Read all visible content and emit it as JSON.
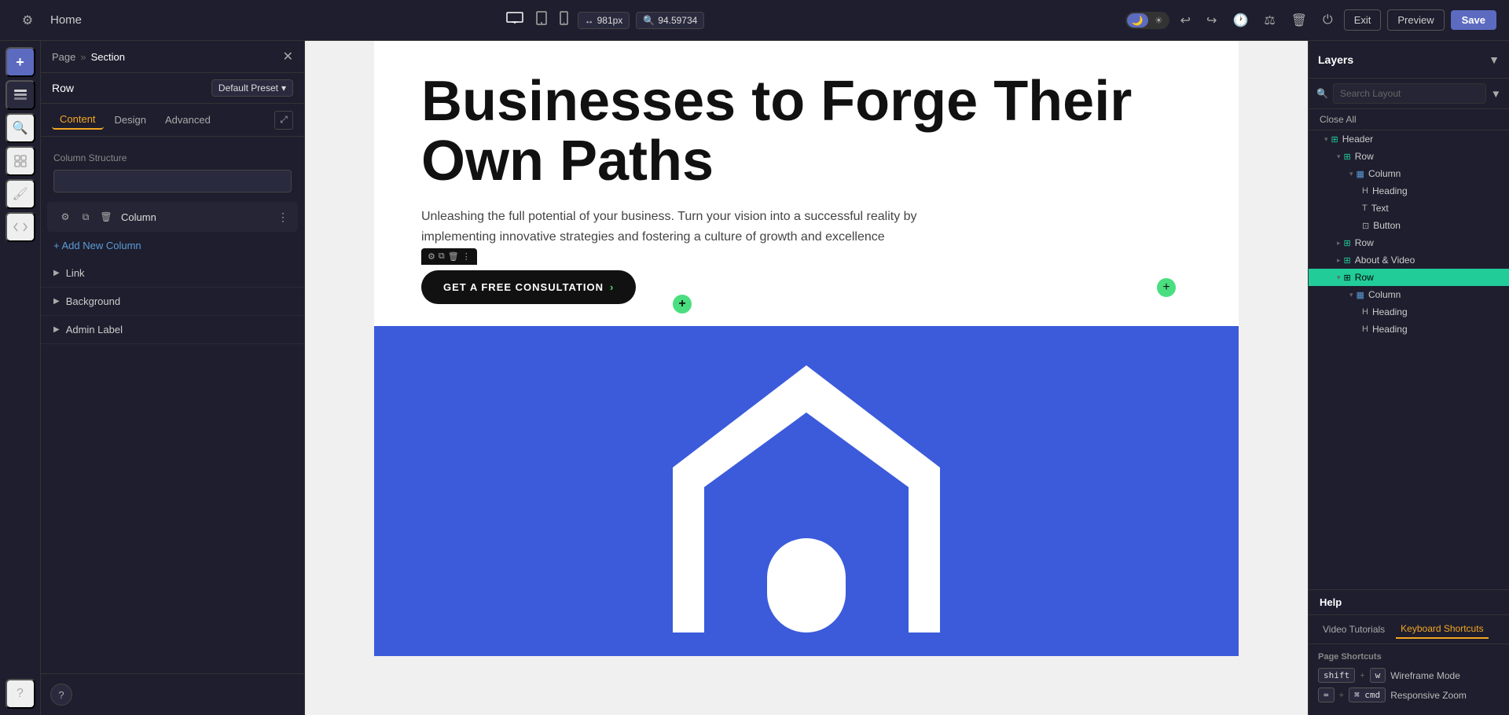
{
  "topbar": {
    "title": "Home",
    "gear_icon": "⚙",
    "device_desktop": "▭",
    "device_tablet": "⬜",
    "device_mobile": "📱",
    "px_label": "981px",
    "ruler_icon": "↔",
    "zoom_label": "94.59734",
    "search_icon": "🔍",
    "undo_icon": "↩",
    "redo_icon": "↪",
    "history_icon": "🕐",
    "settings_icon": "⚖",
    "trash_icon": "🗑",
    "power_icon": "⏻",
    "exit_label": "Exit",
    "preview_label": "Preview",
    "save_label": "Save"
  },
  "left_panel": {
    "breadcrumb_page": "Page",
    "breadcrumb_sep": "»",
    "breadcrumb_section": "Section",
    "row_label": "Row",
    "preset_label": "Default Preset",
    "tab_content": "Content",
    "tab_design": "Design",
    "tab_advanced": "Advanced",
    "column_structure_label": "Column Structure",
    "column_label": "Column",
    "add_column_label": "+ Add New Column",
    "section_link": "Link",
    "section_background": "Background",
    "section_admin": "Admin Label"
  },
  "layers": {
    "title": "Layers",
    "filter_icon": "▼",
    "search_placeholder": "Search Layout",
    "close_all": "Close All",
    "items": [
      {
        "label": "Header",
        "indent": 1,
        "icon": "⊞",
        "type": "row",
        "expand": "▸"
      },
      {
        "label": "Row",
        "indent": 2,
        "icon": "⊞",
        "type": "row",
        "expand": "▸"
      },
      {
        "label": "Column",
        "indent": 3,
        "icon": "▦",
        "type": "col",
        "expand": "▸"
      },
      {
        "label": "Heading",
        "indent": 4,
        "icon": "H",
        "type": "heading"
      },
      {
        "label": "Text",
        "indent": 4,
        "icon": "T",
        "type": "text"
      },
      {
        "label": "Button",
        "indent": 4,
        "icon": "⊡",
        "type": "button"
      },
      {
        "label": "Row",
        "indent": 2,
        "icon": "⊞",
        "type": "row",
        "expand": "▸"
      },
      {
        "label": "About & Video",
        "indent": 2,
        "icon": "⊞",
        "type": "row",
        "expand": "▸"
      },
      {
        "label": "Row",
        "indent": 2,
        "icon": "⊞",
        "type": "row",
        "active": true,
        "expand": "▸"
      },
      {
        "label": "Column",
        "indent": 3,
        "icon": "▦",
        "type": "col",
        "expand": "▸"
      },
      {
        "label": "Heading",
        "indent": 4,
        "icon": "H",
        "type": "heading"
      },
      {
        "label": "Heading",
        "indent": 4,
        "icon": "H",
        "type": "heading"
      }
    ]
  },
  "help": {
    "title": "Help",
    "tab_tutorials": "Video Tutorials",
    "tab_shortcuts": "Keyboard Shortcuts",
    "page_shortcuts_title": "Page Shortcuts",
    "shortcuts": [
      {
        "keys": [
          "shift",
          "+",
          "w"
        ],
        "label": "Wireframe Mode"
      },
      {
        "keys": [
          "=",
          "+",
          "⌘ cmd"
        ],
        "label": "Responsive Zoom"
      }
    ]
  },
  "canvas": {
    "hero_title": "Businesses to Forge Their Own Paths",
    "hero_subtitle": "Unleashing the full potential of your business. Turn your vision into a successful reality by implementing innovative strategies and fostering a culture of growth and excellence",
    "cta_label": "GET A FREE CONSULTATION",
    "cta_arrow": "›"
  }
}
